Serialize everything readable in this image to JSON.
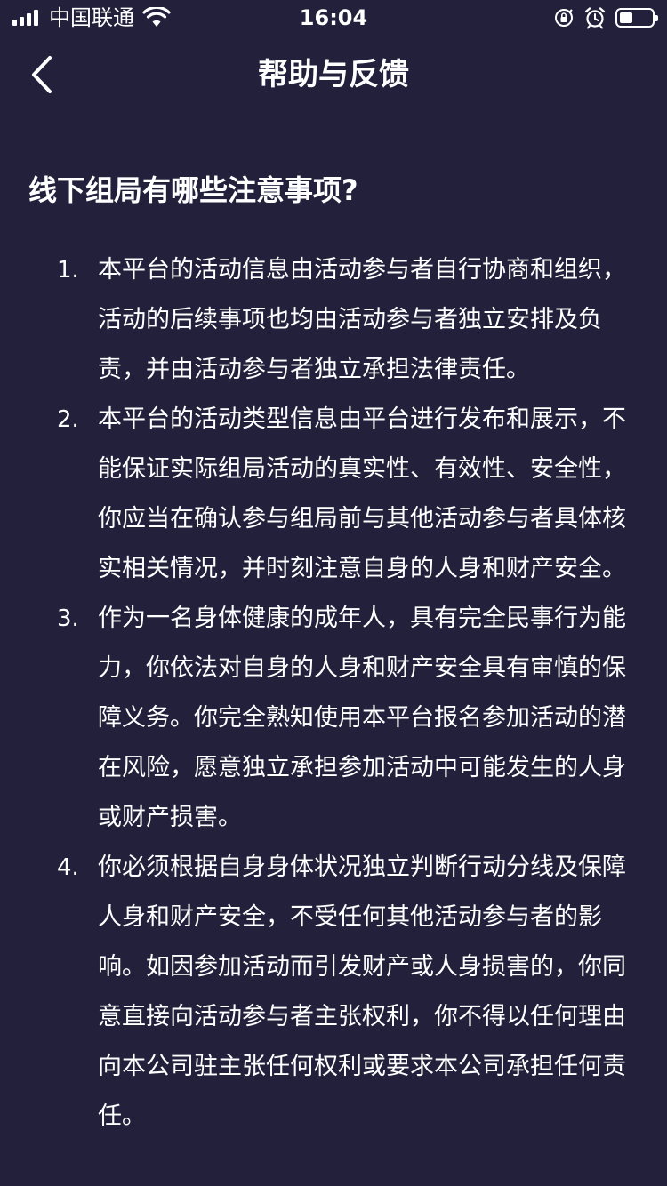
{
  "status_bar": {
    "carrier": "中国联通",
    "time": "16:04",
    "battery_level": 0.4,
    "icons": [
      "signal-icon",
      "wifi-icon",
      "orientation-lock-icon",
      "alarm-icon",
      "battery-icon"
    ]
  },
  "nav": {
    "title": "帮助与反馈",
    "back_icon": "chevron-left-icon"
  },
  "question": {
    "title": "线下组局有哪些注意事项?"
  },
  "answers": [
    {
      "num": "1.",
      "text": "本平台的活动信息由活动参与者自行协商和组织，活动的后续事项也均由活动参与者独立安排及负责，并由活动参与者独立承担法律责任。"
    },
    {
      "num": "2.",
      "text": "本平台的活动类型信息由平台进行发布和展示，不能保证实际组局活动的真实性、有效性、安全性，你应当在确认参与组局前与其他活动参与者具体核实相关情况，并时刻注意自身的人身和财产安全。"
    },
    {
      "num": "3.",
      "text": "作为一名身体健康的成年人，具有完全民事行为能力，你依法对自身的人身和财产安全具有审慎的保障义务。你完全熟知使用本平台报名参加活动的潜在风险，愿意独立承担参加活动中可能发生的人身或财产损害。"
    },
    {
      "num": "4.",
      "text": "你必须根据自身身体状况独立判断行动分线及保障人身和财产安全，不受任何其他活动参与者的影响。如因参加活动而引发财产或人身损害的，你同意直接向活动参与者主张权利，你不得以任何理由向本公司驻主张任何权利或要求本公司承担任何责任。"
    }
  ],
  "colors": {
    "background": "#23203c",
    "text": "#ffffff"
  }
}
